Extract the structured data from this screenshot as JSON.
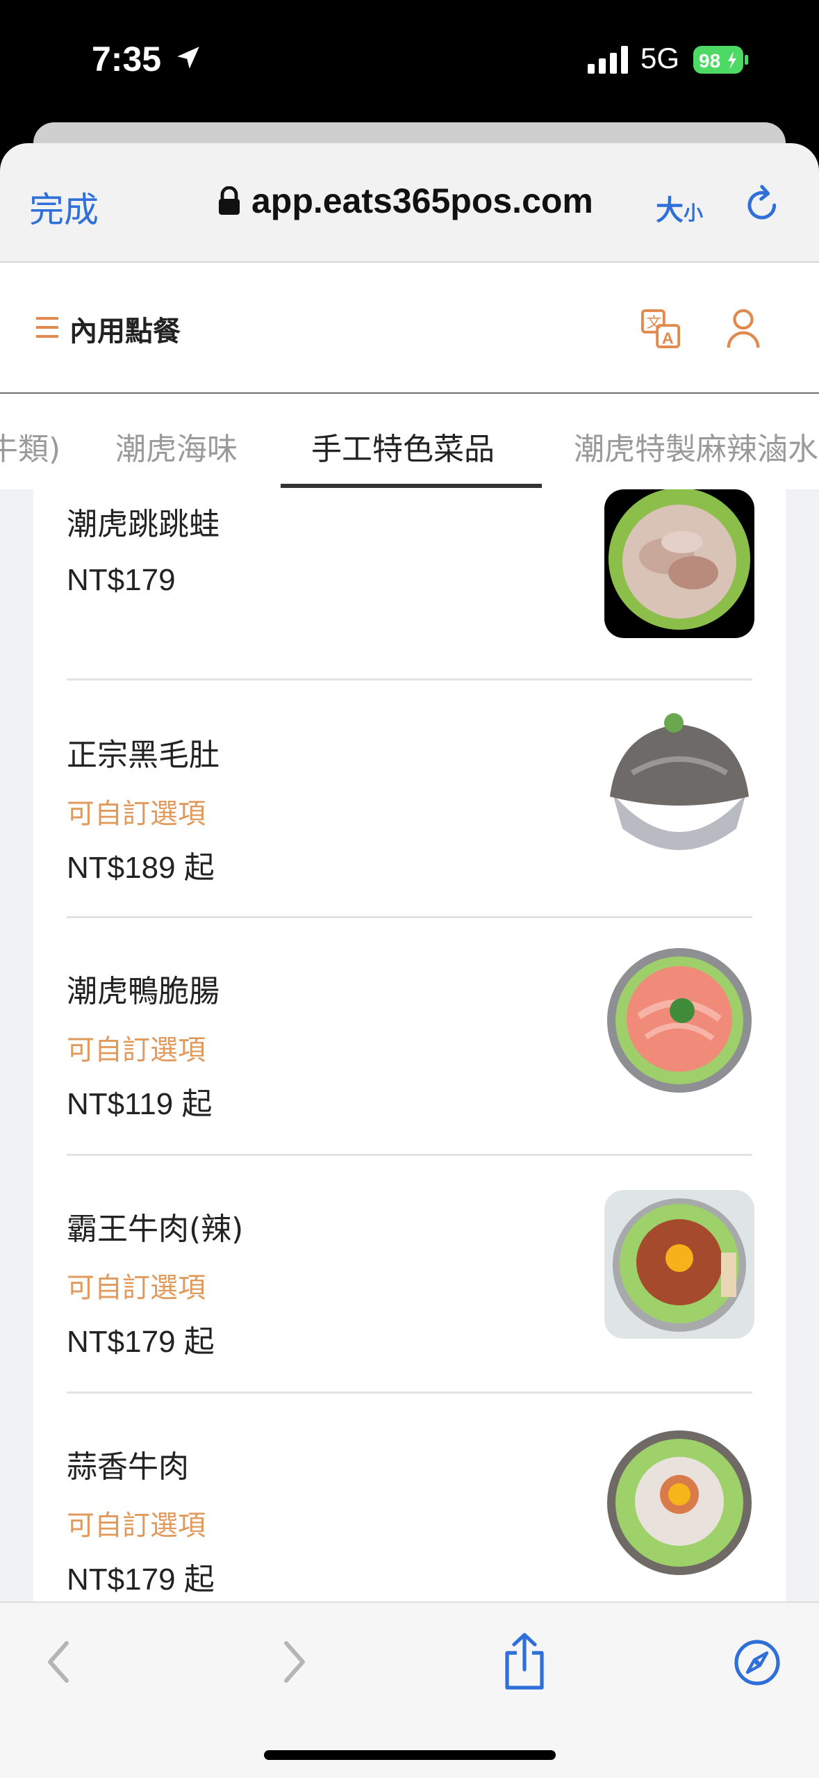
{
  "status_bar": {
    "time": "7:35",
    "network": "5G",
    "battery": "98"
  },
  "browser": {
    "done_label": "完成",
    "url": "app.eats365pos.com",
    "text_size_label": "大",
    "text_size_small": "小"
  },
  "header": {
    "title": "內用點餐"
  },
  "tabs": [
    {
      "label": "牛類)"
    },
    {
      "label": "潮虎海味"
    },
    {
      "label": "手工特色菜品"
    },
    {
      "label": "潮虎特製麻辣滷水"
    }
  ],
  "menu_items": [
    {
      "name": "潮虎跳跳蛙",
      "option": "",
      "price": "NT$179"
    },
    {
      "name": "正宗黑毛肚",
      "option": "可自訂選項",
      "price": "NT$189 起"
    },
    {
      "name": "潮虎鴨脆腸",
      "option": "可自訂選項",
      "price": "NT$119 起"
    },
    {
      "name": "霸王牛肉(辣)",
      "option": "可自訂選項",
      "price": "NT$179 起"
    },
    {
      "name": "蒜香牛肉",
      "option": "可自訂選項",
      "price": "NT$179 起"
    }
  ],
  "colors": {
    "accent": "#e08a4f",
    "ios_blue": "#2e6fd9",
    "option_text": "#e09a5c"
  }
}
